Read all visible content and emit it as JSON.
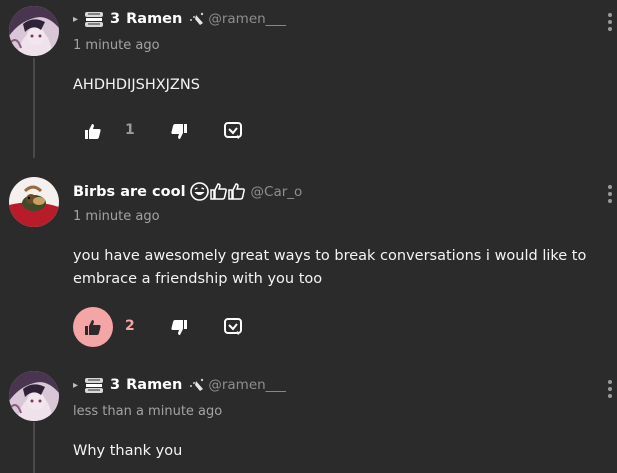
{
  "comments": [
    {
      "reply_marker": "▸",
      "name_prefix_glyph": "3",
      "display_name": "Ramen",
      "handle": "@ramen___",
      "timestamp": "1 minute ago",
      "body": "AHDHDIJSHXJZNS",
      "like_count": "1",
      "liked": false,
      "avatar": "anime-avatar"
    },
    {
      "display_name": "Birbs are cool",
      "handle": "@Car_o",
      "timestamp": "1 minute ago",
      "body": "you have awesomely great ways to break conversations i would like to embrace a friendship with you too",
      "like_count": "2",
      "liked": true,
      "avatar": "bird-avatar"
    },
    {
      "reply_marker": "▸",
      "name_prefix_glyph": "3",
      "display_name": "Ramen",
      "handle": "@ramen___",
      "timestamp": "less than a minute ago",
      "body": "Why thank you",
      "avatar": "anime-avatar"
    }
  ],
  "colors": {
    "background": "#2b2b2b",
    "liked_accent": "#f4a6a6",
    "muted_text": "#a3a3a3",
    "handle_text": "#8e8e8e"
  }
}
